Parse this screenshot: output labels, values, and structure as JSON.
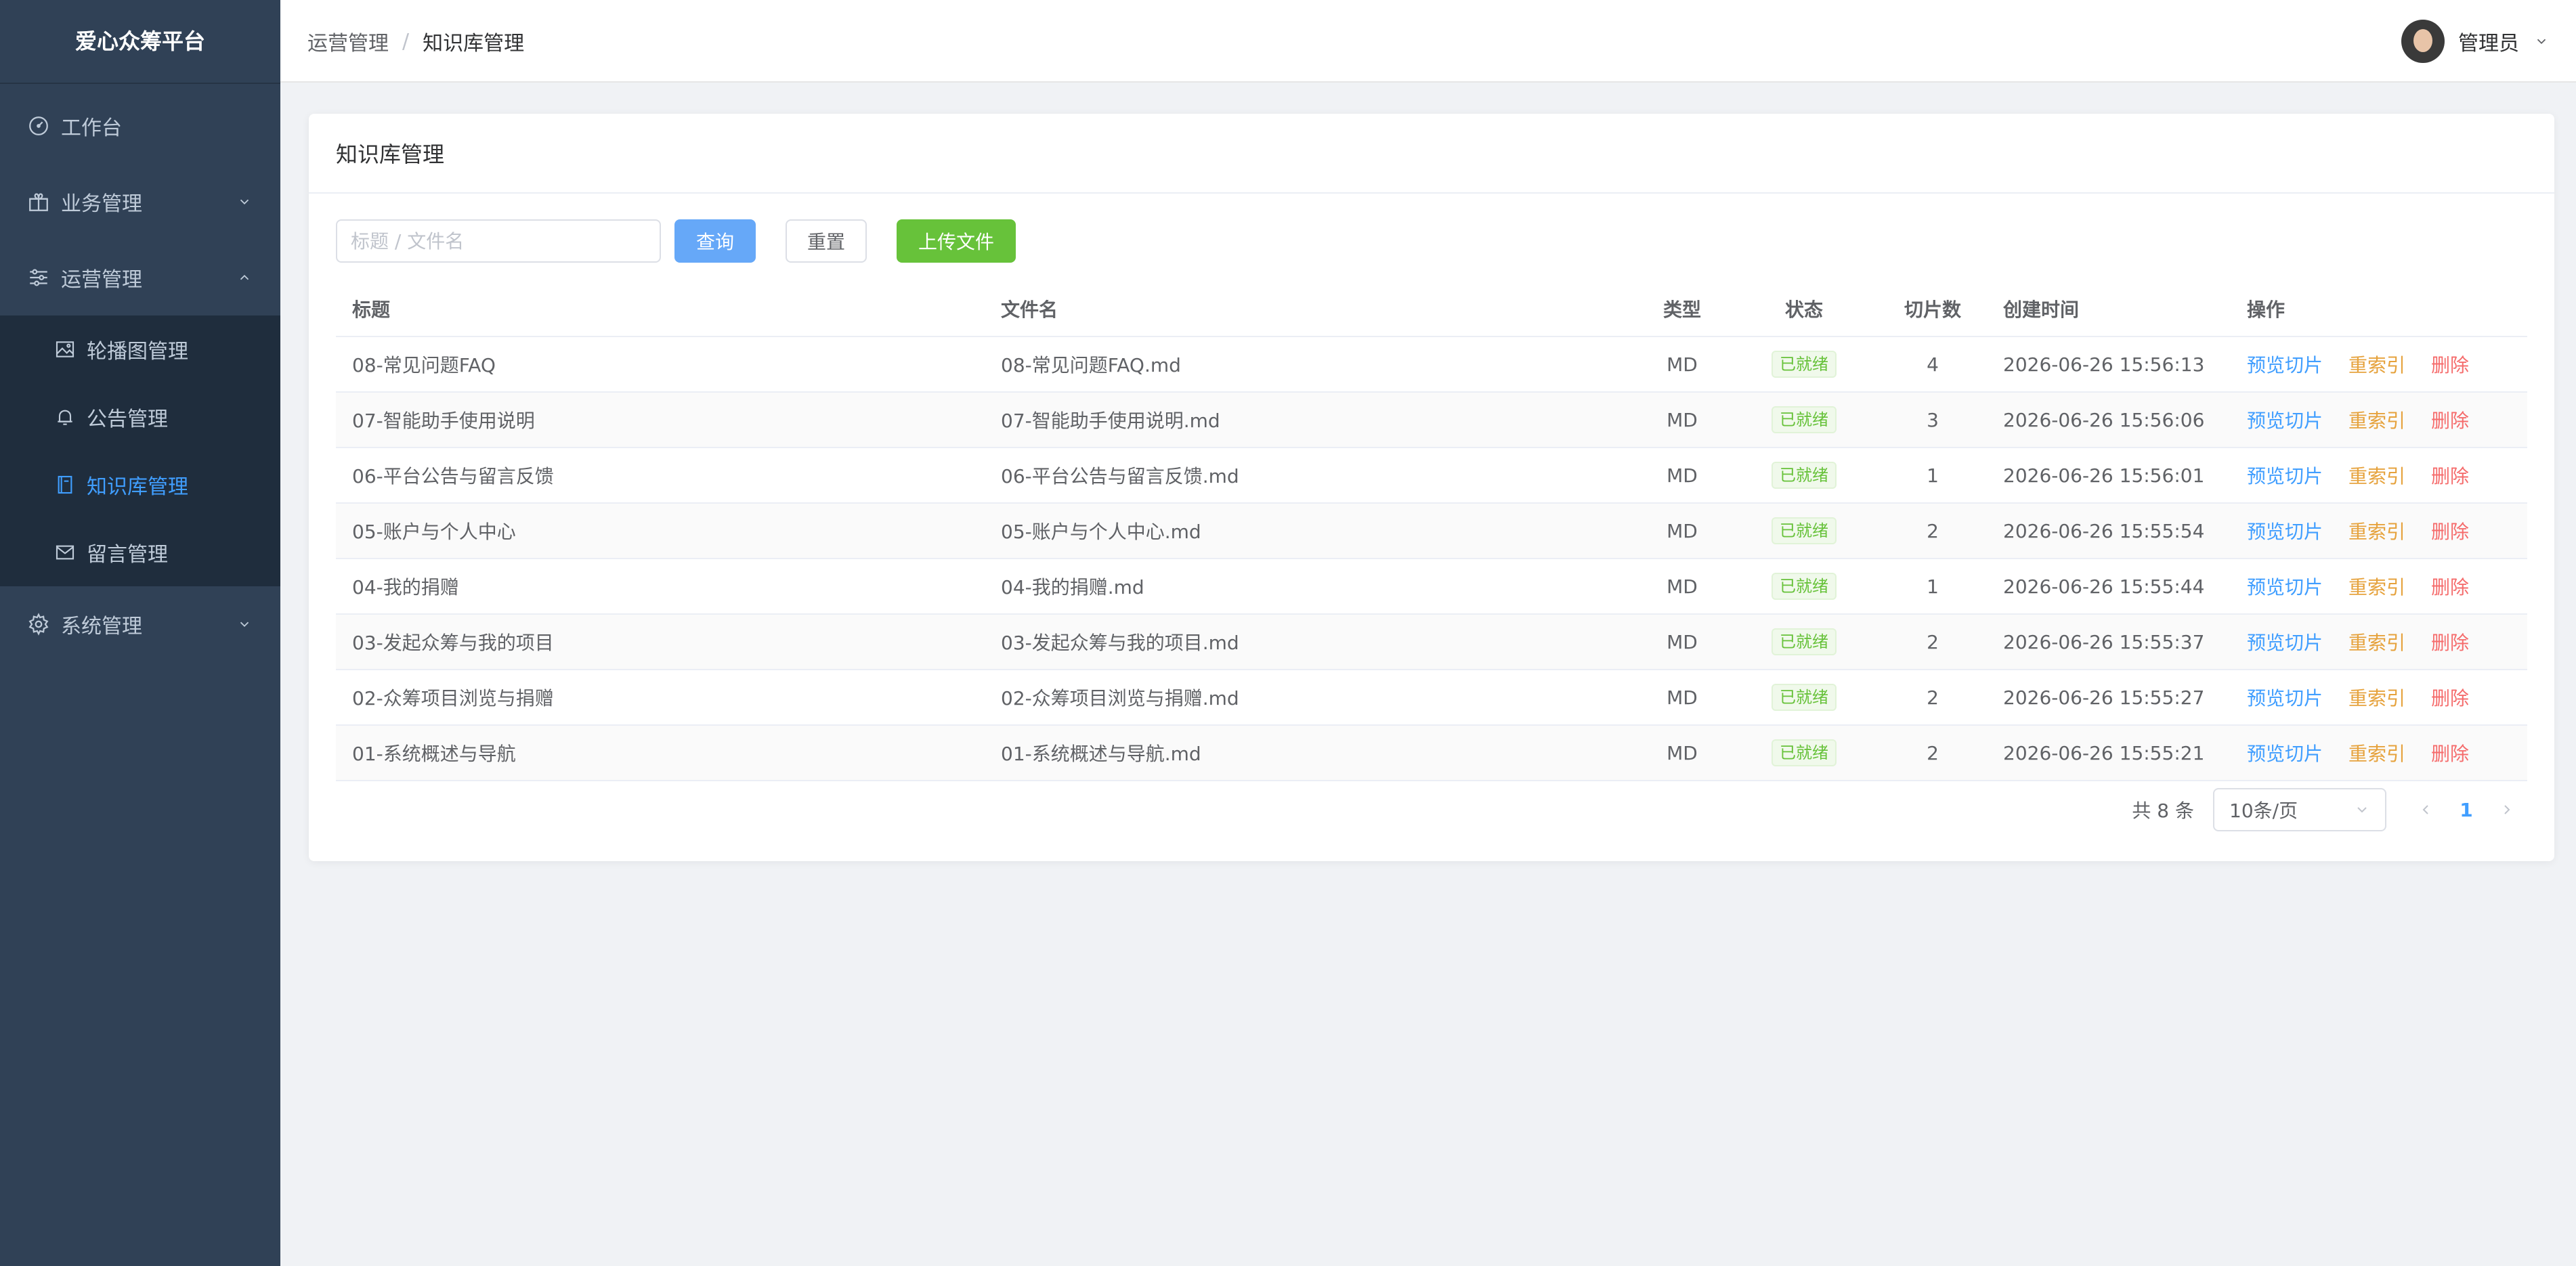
{
  "app": {
    "title": "爱心众筹平台"
  },
  "sidebar": {
    "items": [
      {
        "label": "工作台",
        "icon": "dashboard-icon"
      },
      {
        "label": "业务管理",
        "icon": "gift-icon",
        "expanded": false
      },
      {
        "label": "运营管理",
        "icon": "sliders-icon",
        "expanded": true,
        "children": [
          {
            "label": "轮播图管理",
            "icon": "image-icon"
          },
          {
            "label": "公告管理",
            "icon": "bell-icon"
          },
          {
            "label": "知识库管理",
            "icon": "notebook-icon",
            "active": true
          },
          {
            "label": "留言管理",
            "icon": "mail-icon"
          }
        ]
      },
      {
        "label": "系统管理",
        "icon": "gear-icon",
        "expanded": false
      }
    ]
  },
  "header": {
    "breadcrumb": [
      "运营管理",
      "知识库管理"
    ],
    "breadcrumb_separator": "/",
    "user_name": "管理员"
  },
  "card": {
    "title": "知识库管理"
  },
  "toolbar": {
    "search_placeholder": "标题 / 文件名",
    "search_value": "",
    "query_label": "查询",
    "reset_label": "重置",
    "upload_label": "上传文件"
  },
  "table": {
    "columns": [
      "标题",
      "文件名",
      "类型",
      "状态",
      "切片数",
      "创建时间",
      "操作"
    ],
    "rows": [
      {
        "title": "08-常见问题FAQ",
        "file": "08-常见问题FAQ.md",
        "type": "MD",
        "status": "已就绪",
        "chunks": "4",
        "created": "2026-06-26 15:56:13"
      },
      {
        "title": "07-智能助手使用说明",
        "file": "07-智能助手使用说明.md",
        "type": "MD",
        "status": "已就绪",
        "chunks": "3",
        "created": "2026-06-26 15:56:06"
      },
      {
        "title": "06-平台公告与留言反馈",
        "file": "06-平台公告与留言反馈.md",
        "type": "MD",
        "status": "已就绪",
        "chunks": "1",
        "created": "2026-06-26 15:56:01"
      },
      {
        "title": "05-账户与个人中心",
        "file": "05-账户与个人中心.md",
        "type": "MD",
        "status": "已就绪",
        "chunks": "2",
        "created": "2026-06-26 15:55:54"
      },
      {
        "title": "04-我的捐赠",
        "file": "04-我的捐赠.md",
        "type": "MD",
        "status": "已就绪",
        "chunks": "1",
        "created": "2026-06-26 15:55:44"
      },
      {
        "title": "03-发起众筹与我的项目",
        "file": "03-发起众筹与我的项目.md",
        "type": "MD",
        "status": "已就绪",
        "chunks": "2",
        "created": "2026-06-26 15:55:37"
      },
      {
        "title": "02-众筹项目浏览与捐赠",
        "file": "02-众筹项目浏览与捐赠.md",
        "type": "MD",
        "status": "已就绪",
        "chunks": "2",
        "created": "2026-06-26 15:55:27"
      },
      {
        "title": "01-系统概述与导航",
        "file": "01-系统概述与导航.md",
        "type": "MD",
        "status": "已就绪",
        "chunks": "2",
        "created": "2026-06-26 15:55:21"
      }
    ],
    "ops": {
      "preview": "预览切片",
      "reindex": "重索引",
      "delete": "删除"
    }
  },
  "pagination": {
    "total": "共 8 条",
    "page_size": "10条/页",
    "current_page": "1"
  },
  "colors": {
    "sidebar_bg": "#304156",
    "primary": "#409eff",
    "success": "#67c23a",
    "warning": "#e6a23c",
    "danger": "#f56c6c"
  }
}
